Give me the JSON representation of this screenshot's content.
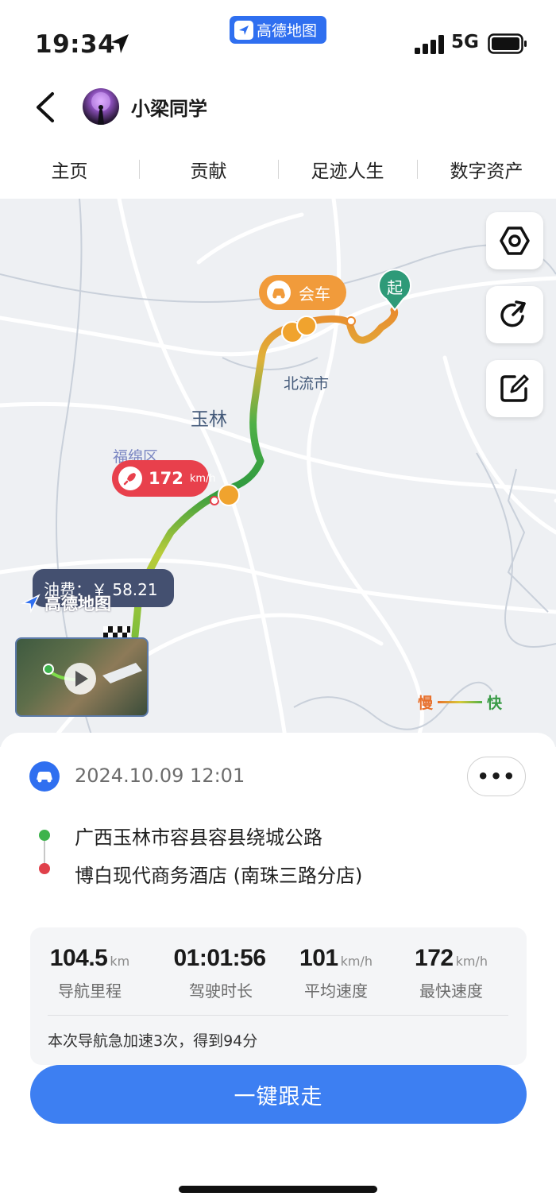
{
  "status_bar": {
    "time": "19:34",
    "network": "5G",
    "app_badge": "高德地图"
  },
  "header": {
    "user_name": "小梁同学"
  },
  "tabs": [
    "主页",
    "贡献",
    "足迹人生",
    "数字资产"
  ],
  "map": {
    "places": {
      "beiliu": "北流市",
      "yulin": "玉林",
      "fumian": "福绵区"
    },
    "start_marker": "起",
    "meet_car_label": "会车",
    "max_speed": {
      "value": "172",
      "unit": "km/h"
    },
    "fuel": "油费：￥ 58.21",
    "watermark": "高德地图",
    "legend": {
      "slow": "慢",
      "fast": "快"
    },
    "controls": [
      "settings-icon",
      "share-icon",
      "edit-icon"
    ]
  },
  "trip": {
    "datetime": "2024.10.09 12:01",
    "more_label": "•••",
    "start_address": "广西玉林市容县容县绕城公路",
    "end_address": "博白现代商务酒店 (南珠三路分店)"
  },
  "stats": [
    {
      "value": "104.5",
      "unit": "km",
      "label": "导航里程"
    },
    {
      "value": "01:01:56",
      "unit": "",
      "label": "驾驶时长"
    },
    {
      "value": "101",
      "unit": "km/h",
      "label": "平均速度"
    },
    {
      "value": "172",
      "unit": "km/h",
      "label": "最快速度"
    }
  ],
  "note": "本次导航急加速3次，得到94分",
  "follow_button": "一键跟走"
}
